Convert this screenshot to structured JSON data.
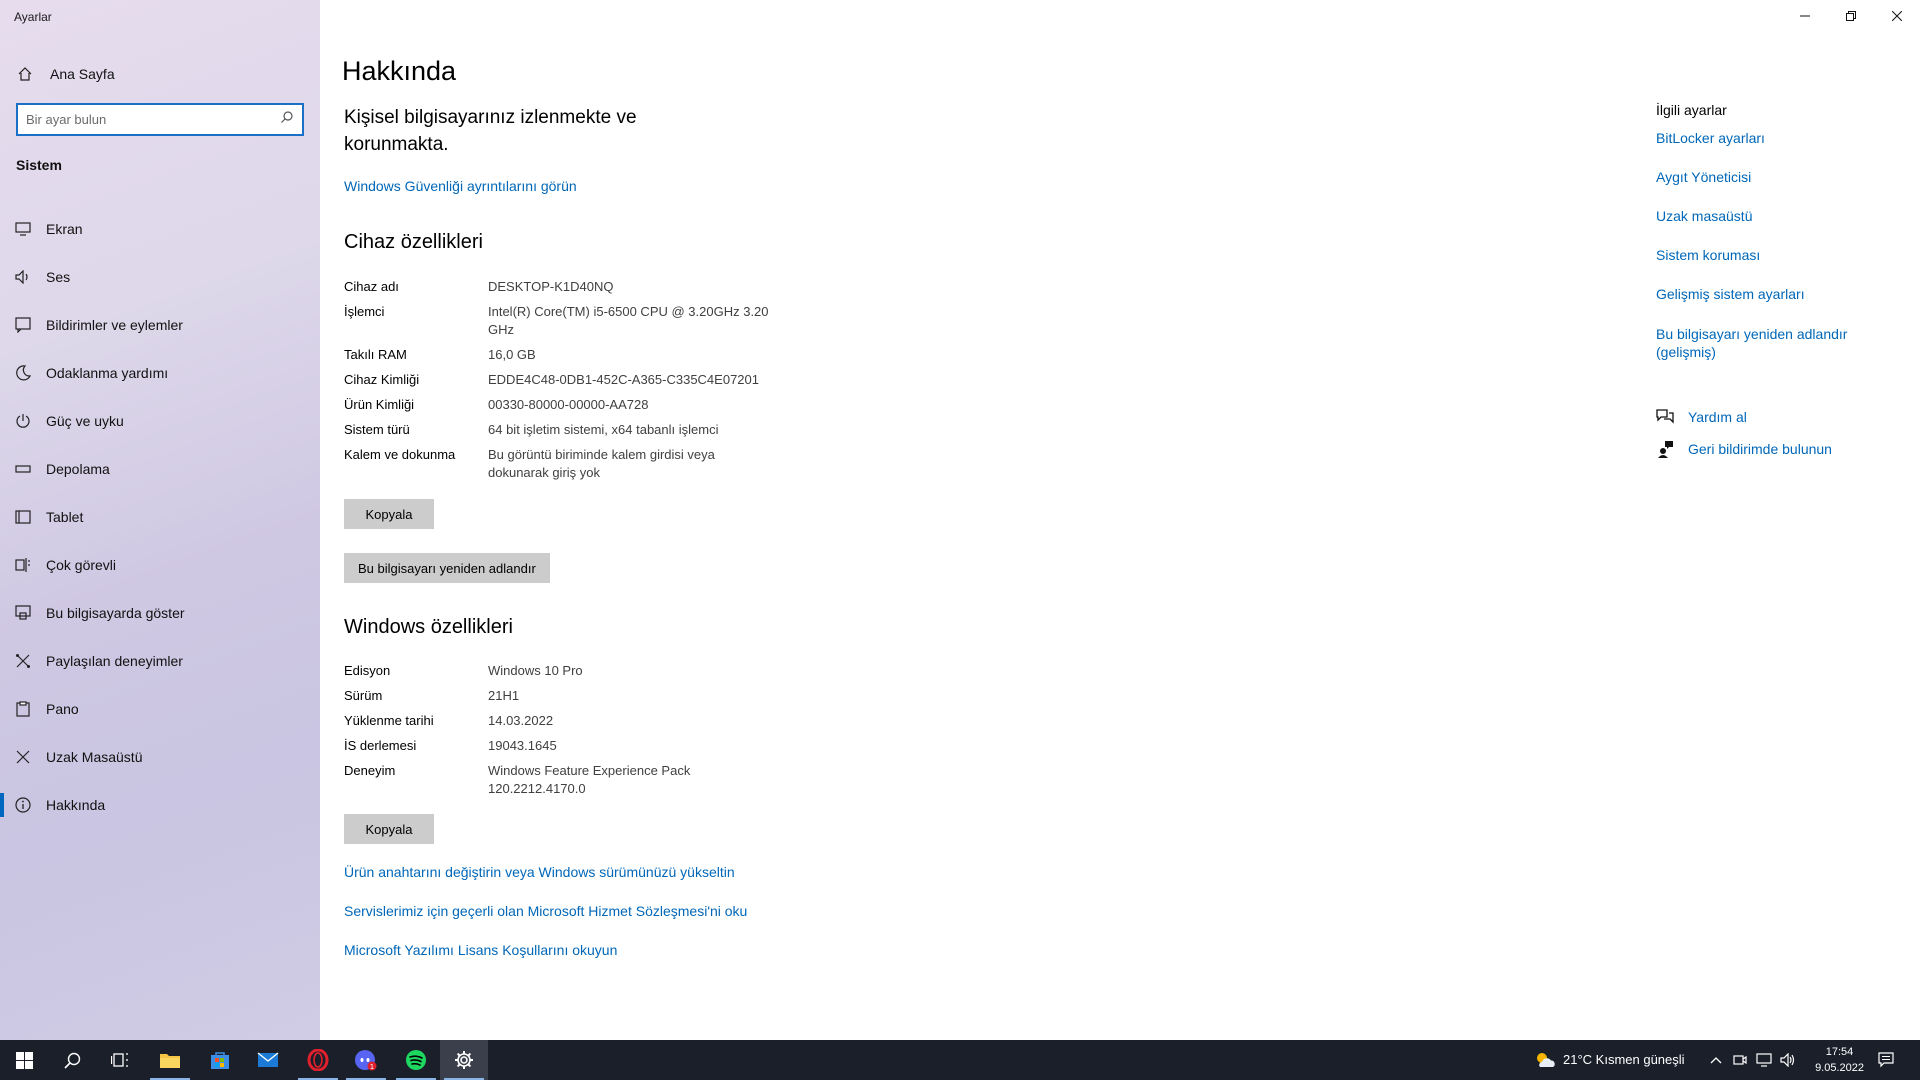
{
  "app": {
    "title": "Ayarlar"
  },
  "sidebar": {
    "home_label": "Ana Sayfa",
    "search_placeholder": "Bir ayar bulun",
    "section": "Sistem",
    "items": [
      {
        "label": "Ekran",
        "icon": "monitor-icon"
      },
      {
        "label": "Ses",
        "icon": "speaker-icon"
      },
      {
        "label": "Bildirimler ve eylemler",
        "icon": "notification-icon"
      },
      {
        "label": "Odaklanma yardımı",
        "icon": "moon-icon"
      },
      {
        "label": "Güç ve uyku",
        "icon": "power-icon"
      },
      {
        "label": "Depolama",
        "icon": "storage-icon"
      },
      {
        "label": "Tablet",
        "icon": "tablet-icon"
      },
      {
        "label": "Çok görevli",
        "icon": "multitask-icon"
      },
      {
        "label": "Bu bilgisayarda göster",
        "icon": "project-icon"
      },
      {
        "label": "Paylaşılan deneyimler",
        "icon": "shared-icon"
      },
      {
        "label": "Pano",
        "icon": "clipboard-icon"
      },
      {
        "label": "Uzak Masaüstü",
        "icon": "remote-icon"
      },
      {
        "label": "Hakkında",
        "icon": "info-icon",
        "active": true
      }
    ]
  },
  "main": {
    "title": "Hakkında",
    "protection_text": "Kişisel bilgisayarınız izlenmekte ve korunmakta.",
    "security_link": "Windows Güvenliği ayrıntılarını görün",
    "device_title": "Cihaz özellikleri",
    "device": [
      {
        "key": "Cihaz adı",
        "value": "DESKTOP-K1D40NQ"
      },
      {
        "key": "İşlemci",
        "value": "Intel(R) Core(TM) i5-6500 CPU @ 3.20GHz   3.20 GHz"
      },
      {
        "key": "Takılı RAM",
        "value": "16,0 GB"
      },
      {
        "key": "Cihaz Kimliği",
        "value": "EDDE4C48-0DB1-452C-A365-C335C4E07201"
      },
      {
        "key": "Ürün Kimliği",
        "value": "00330-80000-00000-AA728"
      },
      {
        "key": "Sistem türü",
        "value": "64 bit işletim sistemi, x64 tabanlı işlemci"
      },
      {
        "key": "Kalem ve dokunma",
        "value": "Bu görüntü biriminde kalem girdisi veya dokunarak giriş yok"
      }
    ],
    "copy_label": "Kopyala",
    "rename_label": "Bu bilgisayarı yeniden adlandır",
    "windows_title": "Windows özellikleri",
    "windows": [
      {
        "key": "Edisyon",
        "value": "Windows 10 Pro"
      },
      {
        "key": "Sürüm",
        "value": "21H1"
      },
      {
        "key": "Yüklenme tarihi",
        "value": "14.03.2022"
      },
      {
        "key": "İS derlemesi",
        "value": "19043.1645"
      },
      {
        "key": "Deneyim",
        "value": "Windows Feature Experience Pack 120.2212.4170.0"
      }
    ],
    "copy2_label": "Kopyala",
    "links": [
      "Ürün anahtarını değiştirin veya Windows sürümünüzü yükseltin",
      "Servislerimiz için geçerli olan Microsoft Hizmet Sözleşmesi'ni oku",
      "Microsoft Yazılımı Lisans Koşullarını okuyun"
    ]
  },
  "related": {
    "header": "İlgili ayarlar",
    "links": [
      "BitLocker ayarları",
      "Aygıt Yöneticisi",
      "Uzak masaüstü",
      "Sistem koruması",
      "Gelişmiş sistem ayarları",
      "Bu bilgisayarı yeniden adlandır (gelişmiş)"
    ],
    "help": "Yardım al",
    "feedback": "Geri bildirimde bulunun"
  },
  "taskbar": {
    "weather": "21°C  Kısmen güneşli",
    "time": "17:54",
    "date": "9.05.2022"
  },
  "colors": {
    "accent": "#0067b8",
    "taskbar": "#1b1f2a"
  }
}
